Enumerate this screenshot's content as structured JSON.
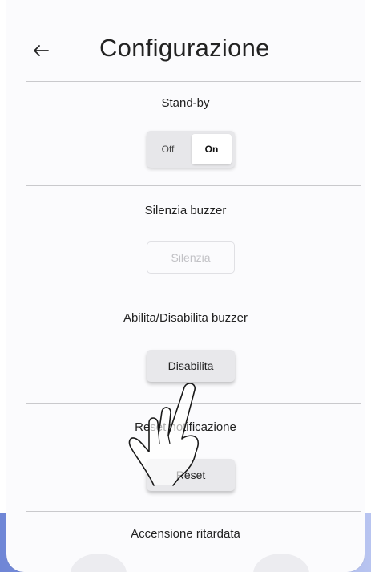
{
  "header": {
    "title": "Configurazione",
    "back_icon": "arrow-left-icon"
  },
  "standby": {
    "label": "Stand-by",
    "off_label": "Off",
    "on_label": "On",
    "selected": "On"
  },
  "silence": {
    "label": "Silenzia buzzer",
    "button_label": "Silenzia"
  },
  "buzzer_toggle": {
    "label": "Abilita/Disabilita buzzer",
    "button_label": "Disabilita"
  },
  "reset": {
    "label": "Reset notificazione",
    "button_label": "Reset"
  },
  "delayed": {
    "label": "Accensione ritardata"
  },
  "colors": {
    "accent_gradient_start": "#6f86d6",
    "accent_gradient_end": "#b8c4f0"
  }
}
